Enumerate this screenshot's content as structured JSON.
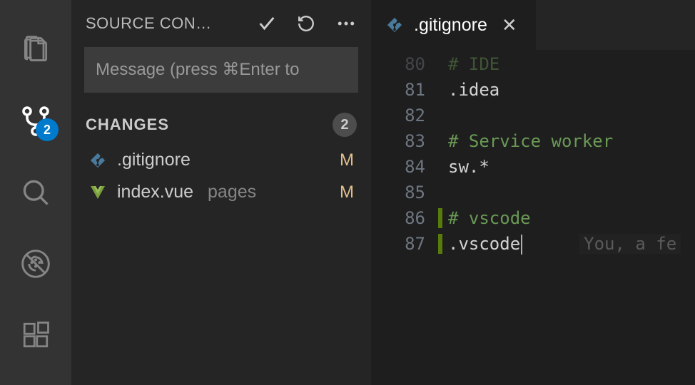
{
  "activityBar": {
    "scmBadge": "2"
  },
  "sidebar": {
    "title": "SOURCE CON…",
    "commitPlaceholder": "Message (press ⌘Enter to",
    "sectionTitle": "CHANGES",
    "changeCount": "2",
    "changes": [
      {
        "name": ".gitignore",
        "path": "",
        "status": "M"
      },
      {
        "name": "index.vue",
        "path": "pages",
        "status": "M"
      }
    ]
  },
  "editor": {
    "tabLabel": ".gitignore",
    "lines": [
      {
        "num": "80",
        "text": "# IDE",
        "cls": "comment",
        "faded": true
      },
      {
        "num": "81",
        "text": ".idea",
        "cls": ""
      },
      {
        "num": "82",
        "text": "",
        "cls": ""
      },
      {
        "num": "83",
        "text": "# Service worker",
        "cls": "comment"
      },
      {
        "num": "84",
        "text": "sw.*",
        "cls": ""
      },
      {
        "num": "85",
        "text": "",
        "cls": ""
      },
      {
        "num": "86",
        "text": "# vscode",
        "cls": "comment",
        "diff": true
      },
      {
        "num": "87",
        "text": ".vscode",
        "cls": "",
        "diff": true,
        "cursor": true,
        "blame": "You, a fe"
      }
    ]
  }
}
